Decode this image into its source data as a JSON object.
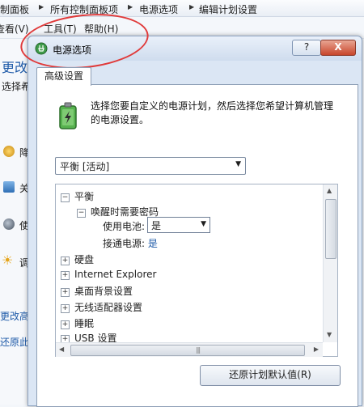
{
  "background": {
    "breadcrumb": [
      "制面板",
      "所有控制面板项",
      "电源选项",
      "编辑计划设置"
    ],
    "menu": [
      "查看(V)",
      "工具(T)",
      "帮助(H)"
    ],
    "left": {
      "heading": "更改",
      "subtext": "选择希",
      "items": [
        "降",
        "关",
        "使",
        "调"
      ],
      "links": [
        "更改高",
        "还原此"
      ]
    }
  },
  "dialog": {
    "title": "电源选项",
    "help_button": "?",
    "close_button": "X",
    "tab": "高级设置",
    "description": "选择您要自定义的电源计划，然后选择您希望计算机管理的电源设置。",
    "plan_select": "平衡 [活动]",
    "tree": {
      "root": "平衡",
      "sub": "唤醒时需要密码",
      "on_battery_label": "使用电池:",
      "on_battery_value": "是",
      "plugged_in_label": "接通电源:",
      "plugged_in_value": "是",
      "items": [
        "硬盘",
        "Internet Explorer",
        "桌面背景设置",
        "无线适配器设置",
        "睡眠",
        "USB 设置"
      ]
    },
    "restore_button": "还原计划默认值(R)"
  }
}
